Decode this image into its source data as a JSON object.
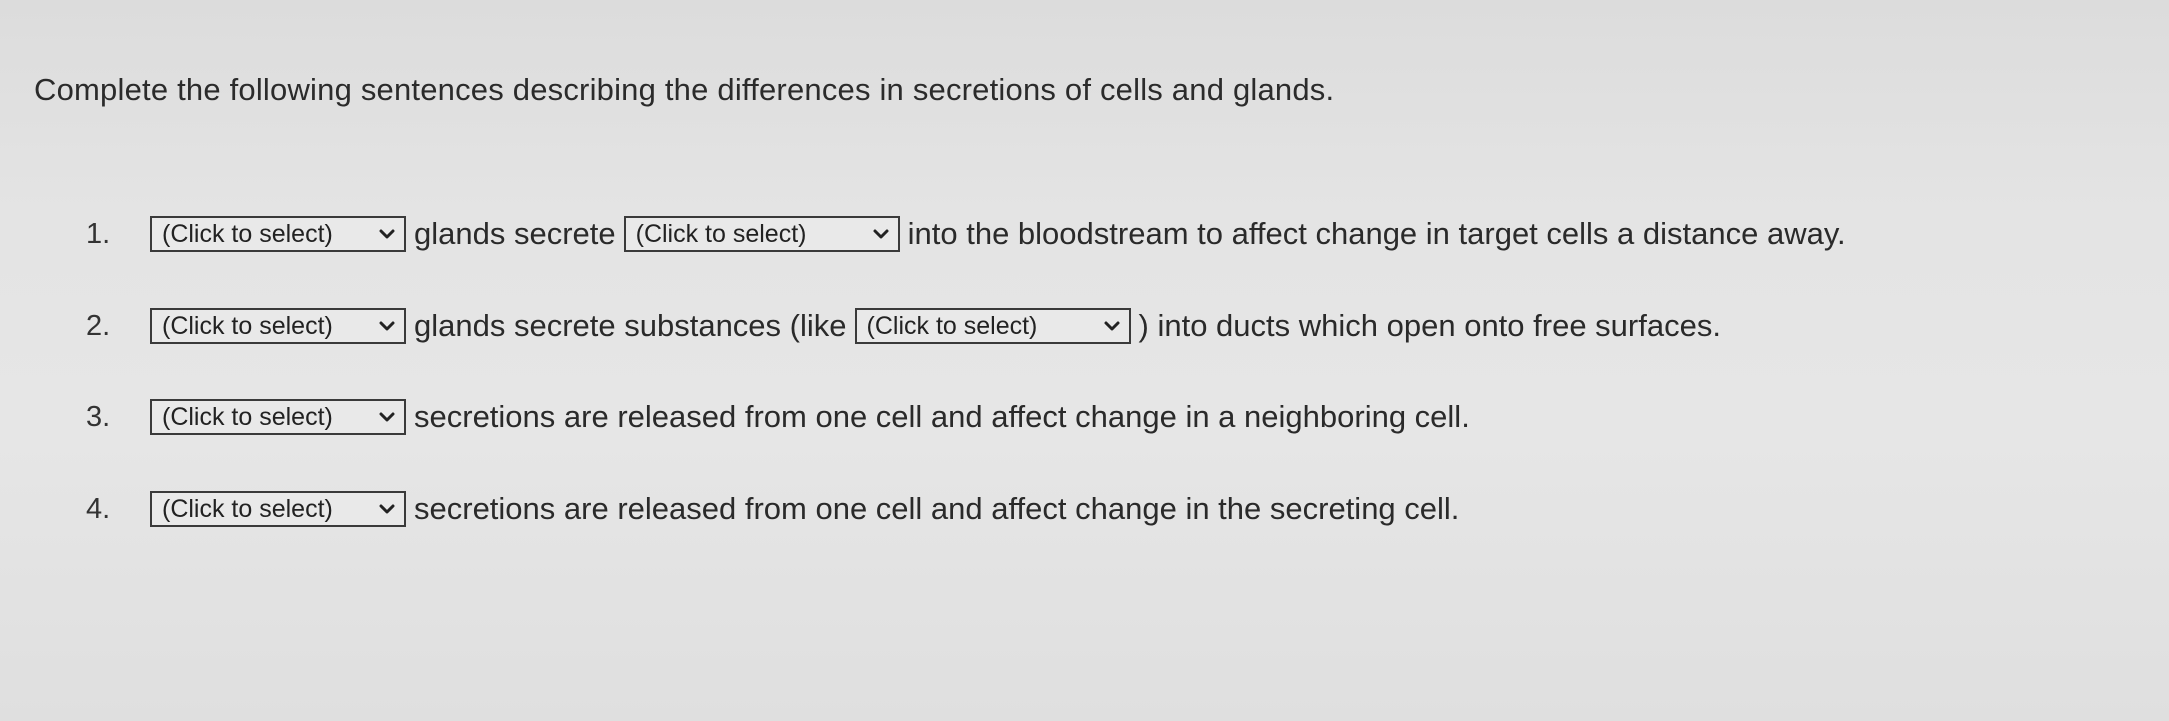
{
  "instructions": "Complete the following sentences describing the differences in secretions of cells and glands.",
  "questions": [
    {
      "number": "1.",
      "select1": "(Click to select)",
      "text1": "glands secrete",
      "select2": "(Click to select)",
      "text2": "into the bloodstream to affect change in target cells a distance away."
    },
    {
      "number": "2.",
      "select1": "(Click to select)",
      "text1": "glands secrete substances (like",
      "select2": "(Click to select)",
      "text2": ") into ducts which open onto free surfaces."
    },
    {
      "number": "3.",
      "select1": "(Click to select)",
      "text1": "secretions are released from one cell and affect change in a neighboring cell."
    },
    {
      "number": "4.",
      "select1": "(Click to select)",
      "text1": "secretions are released from one cell and affect change in the secreting cell."
    }
  ],
  "icons": {
    "dropdown": "chevron-down-icon"
  }
}
